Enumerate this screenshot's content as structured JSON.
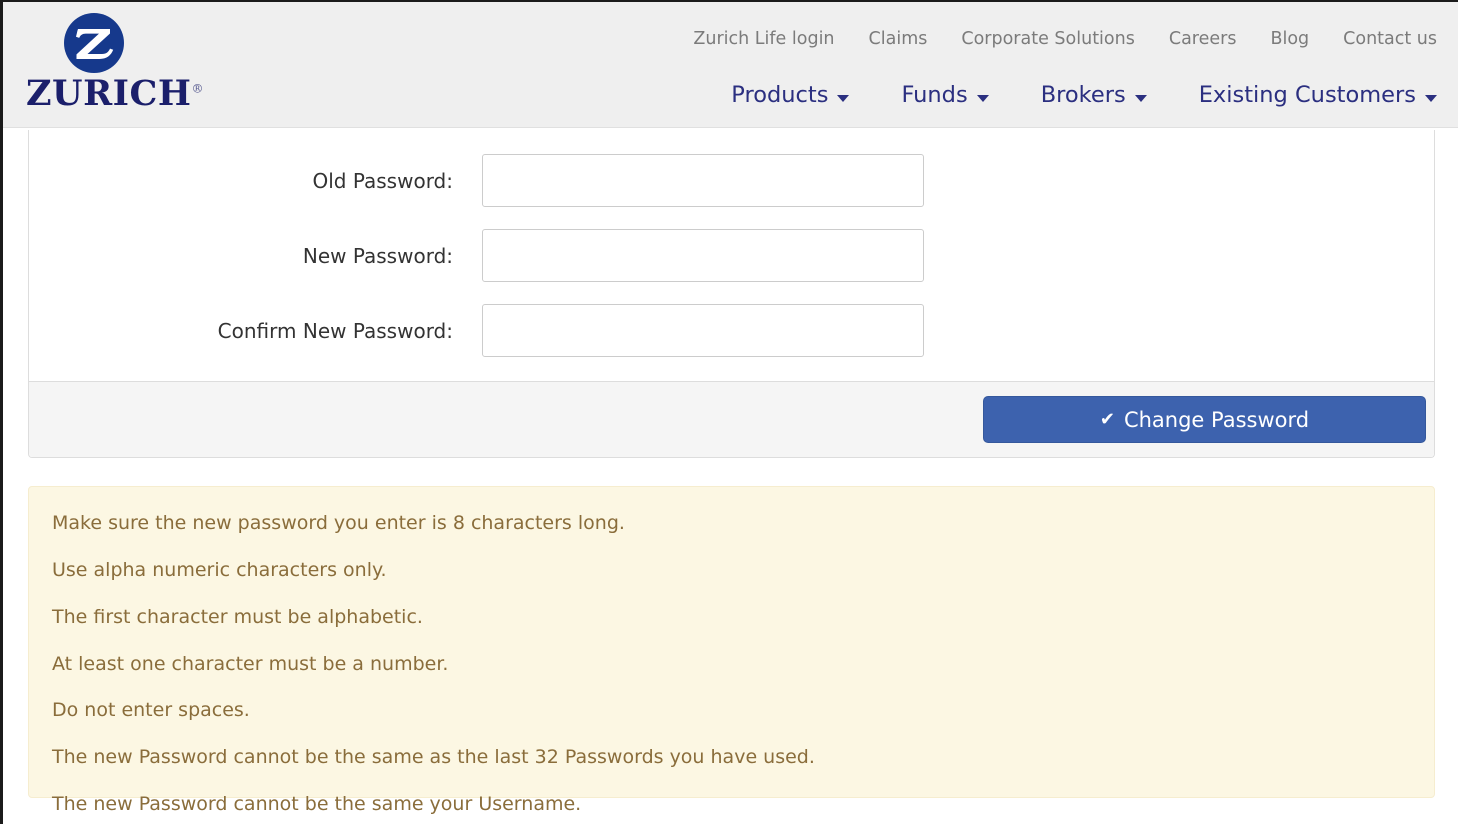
{
  "header": {
    "brand": {
      "logo_icon": "zurich-circle-z-logo",
      "wordmark": "ZURICH",
      "registered_mark": "®"
    },
    "utility_nav": [
      {
        "label": "Zurich Life login"
      },
      {
        "label": "Claims"
      },
      {
        "label": "Corporate Solutions"
      },
      {
        "label": "Careers"
      },
      {
        "label": "Blog"
      },
      {
        "label": "Contact us"
      }
    ],
    "main_nav": [
      {
        "label": "Products",
        "icon": "chevron-down-icon"
      },
      {
        "label": "Funds",
        "icon": "chevron-down-icon"
      },
      {
        "label": "Brokers",
        "icon": "chevron-down-icon"
      },
      {
        "label": "Existing Customers",
        "icon": "chevron-down-icon"
      }
    ]
  },
  "form": {
    "fields": [
      {
        "label": "Old Password:",
        "value": "",
        "placeholder": ""
      },
      {
        "label": "New Password:",
        "value": "",
        "placeholder": ""
      },
      {
        "label": "Confirm New Password:",
        "value": "",
        "placeholder": ""
      }
    ],
    "submit": {
      "label": "Change Password",
      "icon": "check-icon",
      "icon_glyph": "✔"
    }
  },
  "notice": {
    "lines": [
      "Make sure the new password you enter is 8 characters long.",
      "Use alpha numeric characters only.",
      "The first character must be alphabetic.",
      "At least one character must be a number.",
      "Do not enter spaces.",
      "The new Password cannot be the same as the last 32 Passwords you have used.",
      "The new Password cannot be the same your Username."
    ]
  },
  "colors": {
    "header_bg": "#efefef",
    "brand_navy": "#1b1f6b",
    "nav_link": "#7b7b7b",
    "main_nav_link": "#2b2f80",
    "button_blue": "#3d62ae",
    "notice_bg": "#fcf7e3",
    "notice_text": "#8a6d3b",
    "panel_footer_bg": "#f5f5f5",
    "input_border": "#cccccc"
  }
}
